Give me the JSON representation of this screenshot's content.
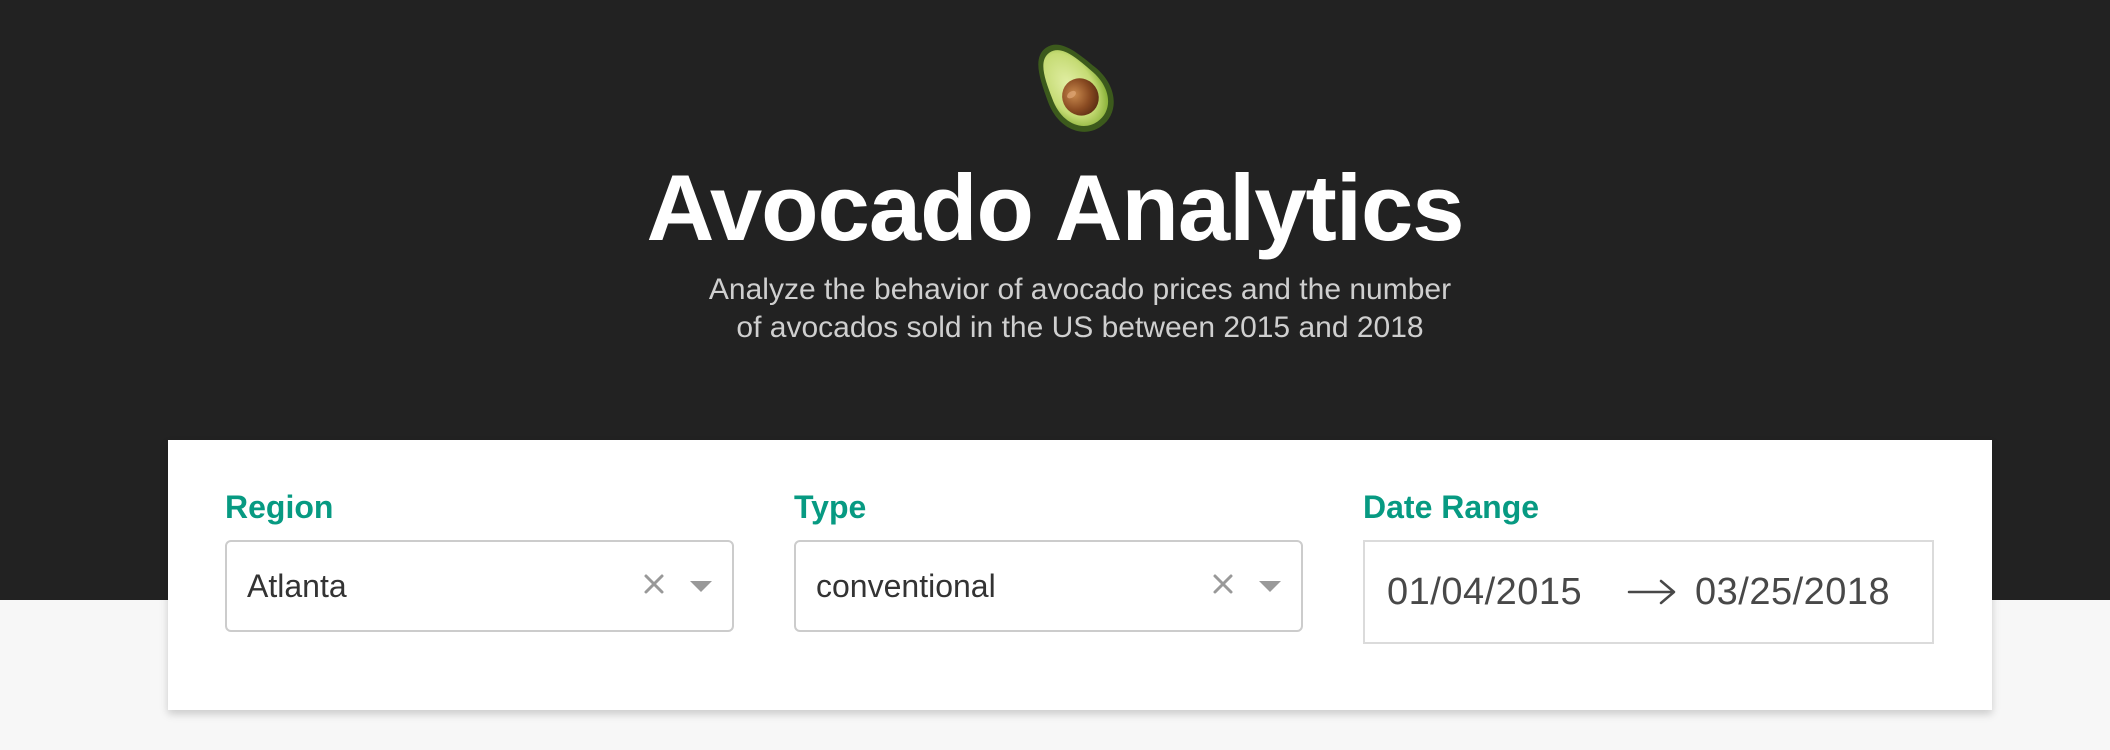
{
  "header": {
    "logo_icon": "avocado-emoji",
    "title": "Avocado Analytics",
    "subtitle": "Analyze the behavior of avocado prices and the number of avocados sold in the US between 2015 and 2018"
  },
  "filters": {
    "region": {
      "label": "Region",
      "value": "Atlanta"
    },
    "type": {
      "label": "Type",
      "value": "conventional"
    },
    "date_range": {
      "label": "Date Range",
      "start": "01/04/2015",
      "end": "03/25/2018"
    }
  },
  "colors": {
    "header_bg": "#222222",
    "page_bg": "#F7F7F7",
    "accent_label": "#079A82",
    "title_text": "#FFFFFF",
    "subtitle_text": "#CFCFCF"
  }
}
